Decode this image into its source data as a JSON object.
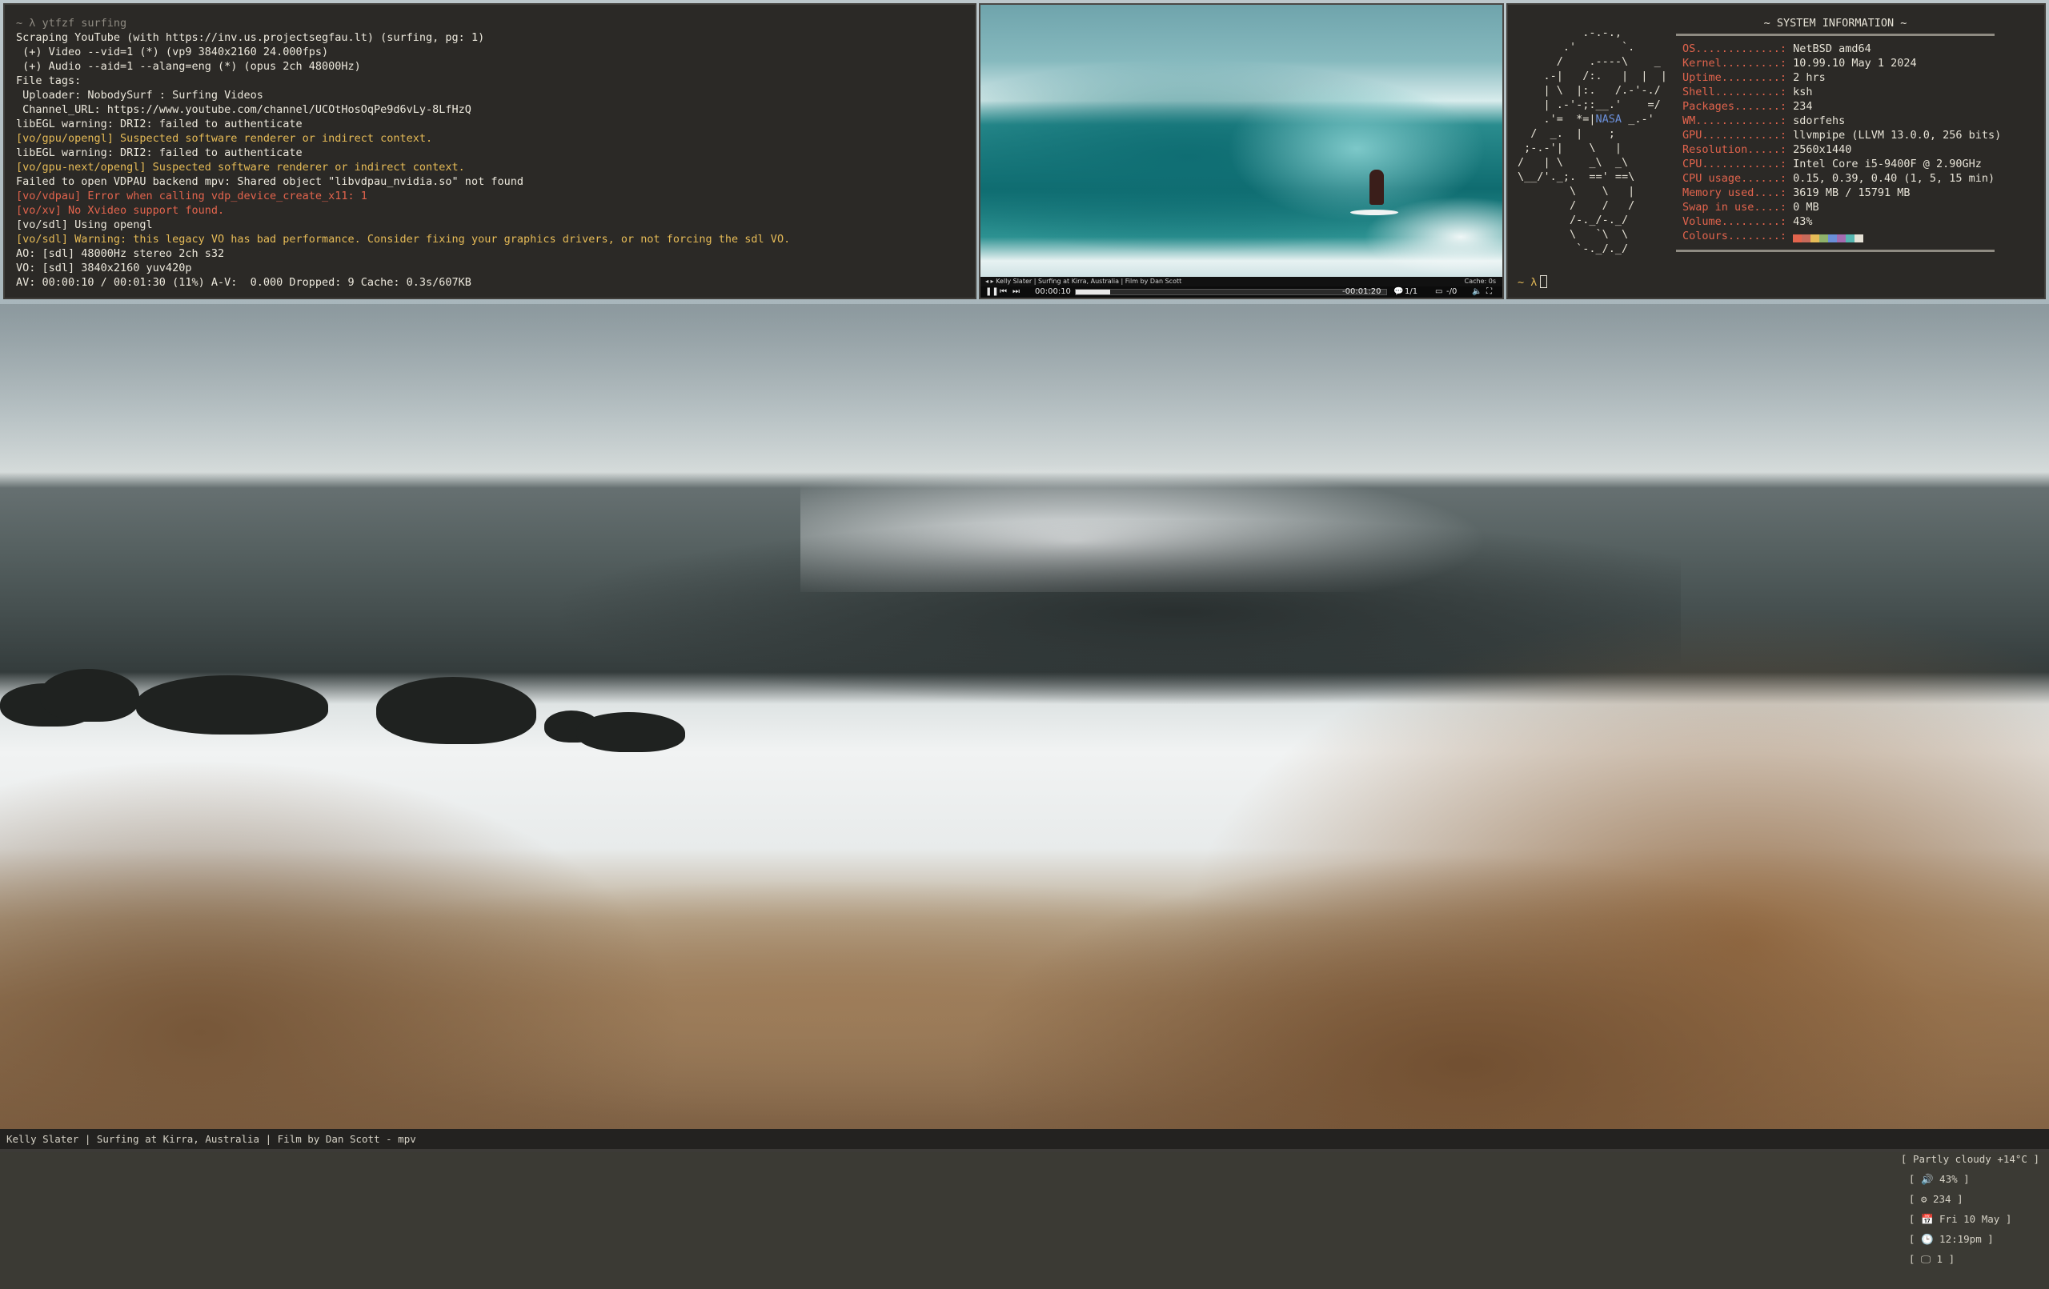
{
  "terminal": {
    "lines": [
      {
        "text": "~ λ ytfzf surfing",
        "tone": "gray"
      },
      {
        "text": "Scraping YouTube (with https://inv.us.projectsegfau.lt) (surfing, pg: 1)",
        "tone": "white"
      },
      {
        "text": " (+) Video --vid=1 (*) (vp9 3840x2160 24.000fps)",
        "tone": "white"
      },
      {
        "text": " (+) Audio --aid=1 --alang=eng (*) (opus 2ch 48000Hz)",
        "tone": "white"
      },
      {
        "text": "File tags:",
        "tone": "white"
      },
      {
        "text": " Uploader: NobodySurf : Surfing Videos",
        "tone": "white"
      },
      {
        "text": " Channel_URL: https://www.youtube.com/channel/UCOtHosOqPe9d6vLy-8LfHzQ",
        "tone": "white"
      },
      {
        "text": "libEGL warning: DRI2: failed to authenticate",
        "tone": "white"
      },
      {
        "text": "[vo/gpu/opengl] Suspected software renderer or indirect context.",
        "tone": "yellow"
      },
      {
        "text": "libEGL warning: DRI2: failed to authenticate",
        "tone": "white"
      },
      {
        "text": "[vo/gpu-next/opengl] Suspected software renderer or indirect context.",
        "tone": "yellow"
      },
      {
        "text": "Failed to open VDPAU backend mpv: Shared object \"libvdpau_nvidia.so\" not found",
        "tone": "white"
      },
      {
        "text": "[vo/vdpau] Error when calling vdp_device_create_x11: 1",
        "tone": "red"
      },
      {
        "text": "[vo/xv] No Xvideo support found.",
        "tone": "red"
      },
      {
        "text": "[vo/sdl] Using opengl",
        "tone": "white"
      },
      {
        "text": "[vo/sdl] Warning: this legacy VO has bad performance. Consider fixing your graphics drivers, or not forcing the sdl VO.",
        "tone": "yellow"
      },
      {
        "text": "AO: [sdl] 48000Hz stereo 2ch s32",
        "tone": "white"
      },
      {
        "text": "VO: [sdl] 3840x2160 yuv420p",
        "tone": "white"
      },
      {
        "text": "AV: 00:00:10 / 00:01:30 (11%) A-V:  0.000 Dropped: 9 Cache: 0.3s/607KB",
        "tone": "white"
      }
    ]
  },
  "mpv": {
    "title": "Kelly Slater | Surfing at Kirra, Australia | Film by Dan Scott",
    "cache_label": "Cache: 0s",
    "time_elapsed": "00:00:10",
    "time_remaining": "-00:01:20",
    "playlist_pos": "1/1",
    "progress": 0.11,
    "subs": "-/0"
  },
  "sysinfo": {
    "header": "~ SYSTEM INFORMATION ~",
    "ascii": [
      "          .-.-.,",
      "       .'       `.",
      "      /    .----\\    _",
      "    .-|   /:.   |  |  |",
      "    | \\  |:.   /.-'-./",
      "    | .-'-;:__.'    =/",
      "    .'=  *=|",
      "  /  _.  |    ;",
      " ;-.-'|    \\   |",
      "/   | \\    _\\  _\\",
      "\\__/'._;.  ==' ==\\",
      "        \\    \\   |",
      "        /    /   /",
      "        /-._/-._/",
      "        \\   `\\  \\",
      "         `-._/._/"
    ],
    "ascii_nasa": "NASA",
    "ascii_nasa_tail": " _.-'",
    "rows": [
      {
        "key": "OS.............:",
        "value": "NetBSD amd64"
      },
      {
        "key": "Kernel.........:",
        "value": "10.99.10 May 1 2024"
      },
      {
        "key": "Uptime.........:",
        "value": "2 hrs"
      },
      {
        "key": "Shell..........:",
        "value": "ksh"
      },
      {
        "key": "Packages.......:",
        "value": "234"
      },
      {
        "key": "WM.............:",
        "value": "sdorfehs"
      },
      {
        "key": "GPU............:",
        "value": "llvmpipe (LLVM 13.0.0, 256 bits)"
      },
      {
        "key": "Resolution.....:",
        "value": "2560x1440"
      },
      {
        "key": "CPU............:",
        "value": "Intel Core i5-9400F @ 2.90GHz"
      },
      {
        "key": "CPU usage......:",
        "value": "0.15, 0.39, 0.40 (1, 5, 15 min)"
      },
      {
        "key": "Memory used....:",
        "value": "3619 MB / 15791 MB"
      },
      {
        "key": "Swap in use....:",
        "value": "0 MB"
      },
      {
        "key": "Volume.........:",
        "value": "43%"
      },
      {
        "key": "Colours........:",
        "value": ""
      }
    ],
    "colours": [
      "#e2644d",
      "#c86a5a",
      "#e6bb57",
      "#8fb26b",
      "#6b8fd8",
      "#a46bb0",
      "#56b6b0",
      "#e6e2d6"
    ],
    "prompt": "~ λ"
  },
  "statusbar": {
    "window_title": "Kelly Slater | Surfing at Kirra, Australia | Film by Dan Scott - mpv",
    "weather": "[ Partly cloudy +14°C ]",
    "volume": "[ 🔊 43% ]",
    "packages": "[ ⚙ 234 ]",
    "date": "[ 📅 Fri 10 May ]",
    "time": "[ 🕒 12:19pm ]",
    "workspace": "[ 🖵 1 ]"
  }
}
